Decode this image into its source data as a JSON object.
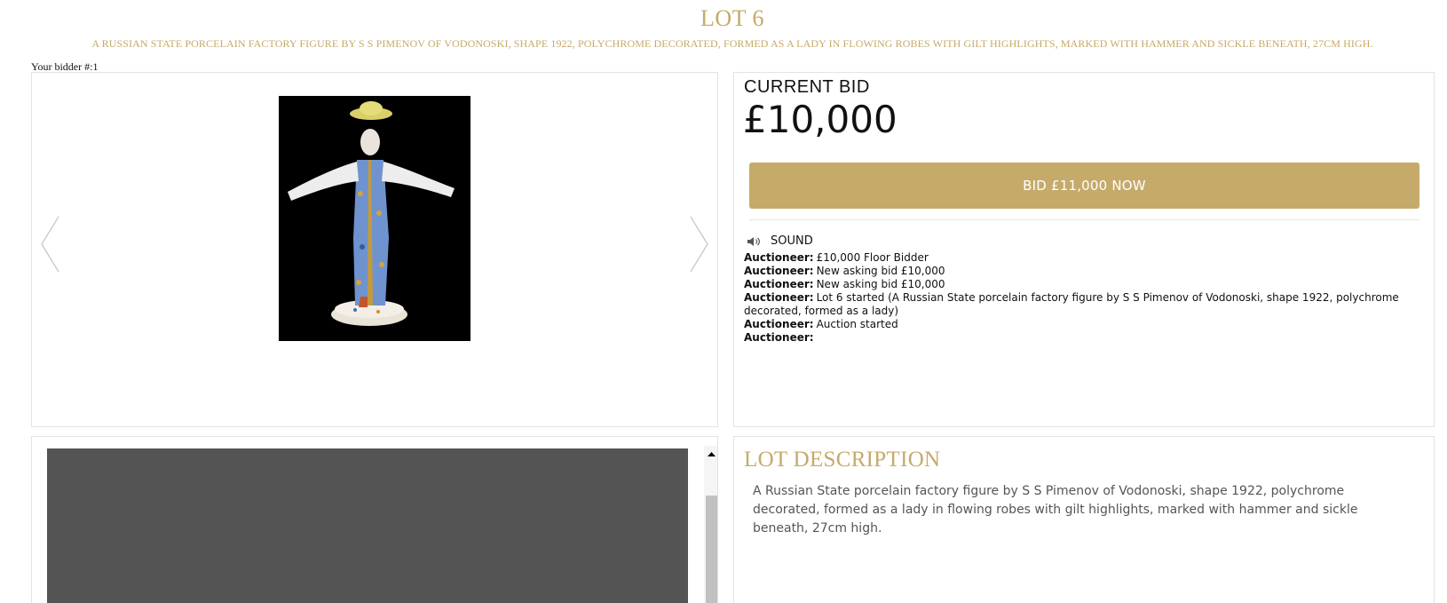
{
  "lot": {
    "title": "LOT 6",
    "subtitle": "A RUSSIAN STATE PORCELAIN FACTORY FIGURE BY S S PIMENOV OF VODONOSKI, SHAPE 1922, POLYCHROME DECORATED, FORMED AS A LADY IN FLOWING ROBES WITH GILT HIGHLIGHTS, MARKED WITH HAMMER AND SICKLE BENEATH, 27CM HIGH."
  },
  "bidder": {
    "label": "Your bidder #:1"
  },
  "gallery": {
    "prev_icon": "chevron-left-icon",
    "next_icon": "chevron-right-icon"
  },
  "bidding": {
    "current_bid_label": "CURRENT BID",
    "current_bid_value": "£10,000",
    "bid_button_label": "BID £11,000 NOW",
    "accent_color": "#c5aa6a"
  },
  "sound": {
    "label": "SOUND",
    "icon": "speaker-icon"
  },
  "auction_log": [
    {
      "speaker": "Auctioneer:",
      "message": "£10,000 Floor Bidder"
    },
    {
      "speaker": "Auctioneer:",
      "message": "New asking bid £10,000"
    },
    {
      "speaker": "Auctioneer:",
      "message": "New asking bid £10,000"
    },
    {
      "speaker": "Auctioneer:",
      "message": "Lot 6 started (A Russian State porcelain factory figure by S S Pimenov of Vodonoski, shape 1922, polychrome decorated, formed as a lady)"
    },
    {
      "speaker": "Auctioneer:",
      "message": "Auction started"
    },
    {
      "speaker": "Auctioneer:",
      "message": ""
    }
  ],
  "description": {
    "title": "LOT DESCRIPTION",
    "text": "A Russian State porcelain factory figure by S S Pimenov of Vodonoski, shape 1922, polychrome decorated, formed as a lady in flowing robes with gilt highlights, marked with hammer and sickle beneath, 27cm high."
  }
}
